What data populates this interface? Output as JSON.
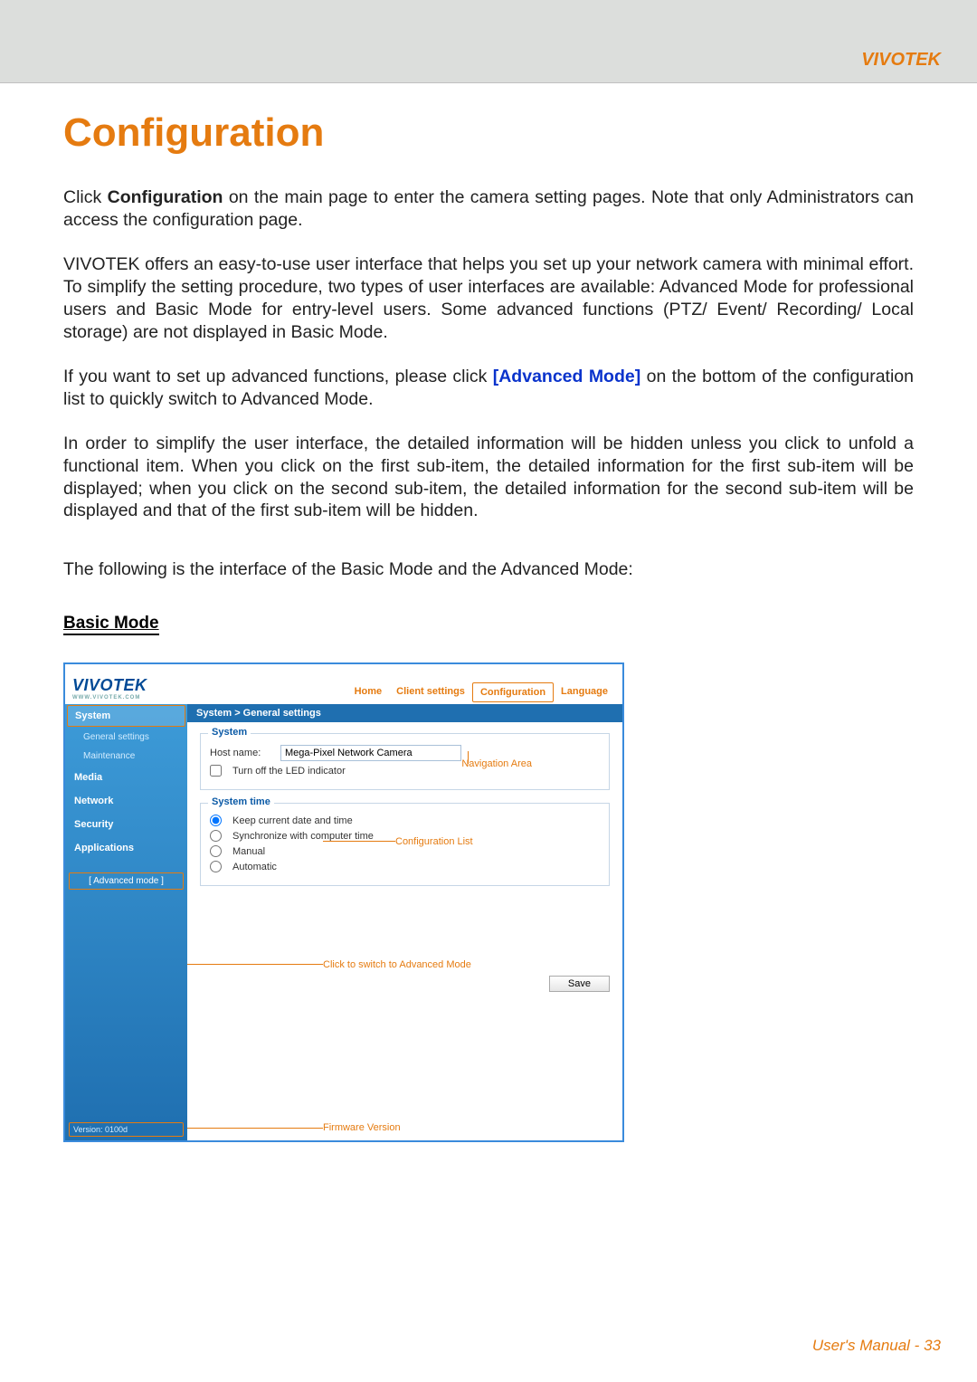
{
  "header": {
    "brand": "VIVOTEK"
  },
  "title": "Configuration",
  "paragraphs": {
    "p1a": "Click ",
    "p1b": "Configuration",
    "p1c": " on the main page to enter the camera setting pages. Note that only Administrators can access the configuration page.",
    "p2": "VIVOTEK offers an easy-to-use user interface that helps you set up your network camera with minimal effort. To simplify the setting procedure, two types of user interfaces are available: Advanced Mode for professional users and Basic Mode for entry-level users. Some advanced functions (PTZ/ Event/ Recording/ Local storage) are not displayed in Basic Mode.",
    "p3a": "If you want to set up advanced functions, please click ",
    "p3b": "[Advanced Mode]",
    "p3c": " on the bottom of the configuration list to quickly switch to Advanced Mode.",
    "p4": "In order to simplify the user interface, the detailed information will be hidden unless you click to unfold a functional item. When you click on the first sub-item, the detailed information for the first sub-item will be displayed; when you click on the second sub-item, the detailed information for the second sub-item will be displayed and that of the first sub-item will be hidden.",
    "p5": "The following is the interface of the Basic Mode and the Advanced Mode:"
  },
  "subhead": "Basic Mode",
  "ui": {
    "logo": "VIVOTEK",
    "logo_sub": "WWW.VIVOTEK.COM",
    "topnav": {
      "home": "Home",
      "client": "Client settings",
      "config": "Configuration",
      "lang": "Language"
    },
    "breadcrumb": "System  >  General settings",
    "sidebar": {
      "system": "System",
      "general": "General settings",
      "maintenance": "Maintenance",
      "media": "Media",
      "network": "Network",
      "security": "Security",
      "applications": "Applications",
      "advanced": "[ Advanced mode ]",
      "version": "Version: 0100d"
    },
    "system_panel": {
      "legend": "System",
      "hostname_label": "Host name:",
      "hostname_value": "Mega-Pixel Network Camera",
      "led_label": "Turn off the LED indicator"
    },
    "time_panel": {
      "legend": "System time",
      "opt1": "Keep current date and time",
      "opt2": "Synchronize with computer time",
      "opt3": "Manual",
      "opt4": "Automatic"
    },
    "save": "Save",
    "callouts": {
      "nav": "Navigation Area",
      "conf": "Configuration List",
      "adv": "Click to switch to Advanced Mode",
      "fw": "Firmware Version"
    }
  },
  "footer": {
    "label": "User's Manual - ",
    "page": "33"
  }
}
